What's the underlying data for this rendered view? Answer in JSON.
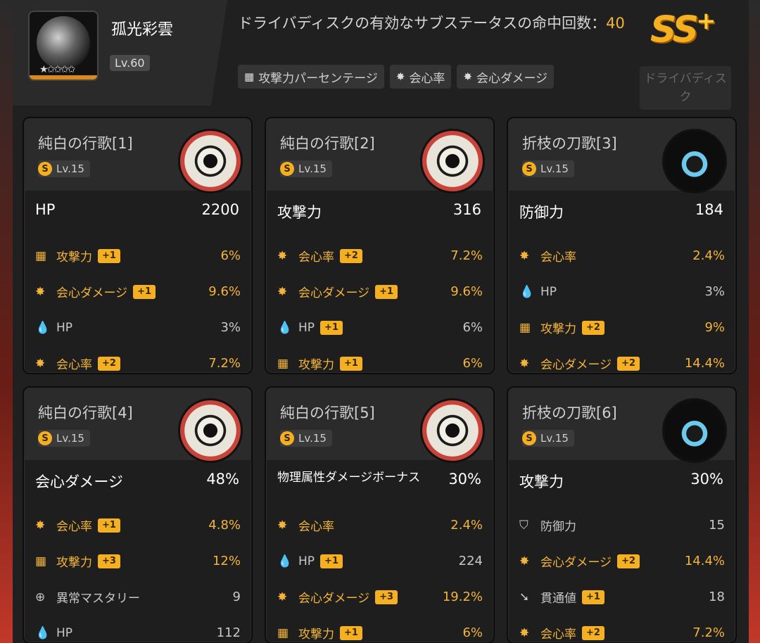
{
  "character": {
    "name": "孤光彩雲",
    "level": "Lv.60",
    "stars": "★✩✩✩✩"
  },
  "header": {
    "description_prefix": "ドライバディスクの有効なサブステータスの命中回数：",
    "description_count": "40",
    "tags": [
      {
        "icon": "attack-icon",
        "glyph": "▦",
        "label": "攻撃力パーセンテージ"
      },
      {
        "icon": "crit-icon",
        "glyph": "✸",
        "label": "会心率"
      },
      {
        "icon": "crit-icon",
        "glyph": "✸",
        "label": "会心ダメージ"
      }
    ],
    "rank": "SS",
    "rank_plus": "+",
    "disc_button": "ドライバディスク"
  },
  "colors": {
    "accent": "#f4b43a",
    "badge": "#f4b021",
    "card_bg": "#1e1e1e"
  },
  "cards": [
    {
      "title": "純白の行歌[1]",
      "level": "Lv.15",
      "disc": "white",
      "main_name": "HP",
      "main_value": "2200",
      "subs": [
        {
          "icon": "attack-icon",
          "glyph": "▦",
          "name": "攻撃力",
          "badge": "+1",
          "value": "6%",
          "active": true
        },
        {
          "icon": "crit-icon",
          "glyph": "✸",
          "name": "会心ダメージ",
          "badge": "+1",
          "value": "9.6%",
          "active": true
        },
        {
          "icon": "hp-icon",
          "glyph": "💧",
          "name": "HP",
          "badge": "",
          "value": "3%",
          "active": false
        },
        {
          "icon": "crit-icon",
          "glyph": "✸",
          "name": "会心率",
          "badge": "+2",
          "value": "7.2%",
          "active": true
        }
      ]
    },
    {
      "title": "純白の行歌[2]",
      "level": "Lv.15",
      "disc": "white",
      "main_name": "攻撃力",
      "main_value": "316",
      "subs": [
        {
          "icon": "crit-icon",
          "glyph": "✸",
          "name": "会心率",
          "badge": "+2",
          "value": "7.2%",
          "active": true
        },
        {
          "icon": "crit-icon",
          "glyph": "✸",
          "name": "会心ダメージ",
          "badge": "+1",
          "value": "9.6%",
          "active": true
        },
        {
          "icon": "hp-icon",
          "glyph": "💧",
          "name": "HP",
          "badge": "+1",
          "value": "6%",
          "active": false
        },
        {
          "icon": "attack-icon",
          "glyph": "▦",
          "name": "攻撃力",
          "badge": "+1",
          "value": "6%",
          "active": true
        }
      ]
    },
    {
      "title": "折枝の刀歌[3]",
      "level": "Lv.15",
      "disc": "blue",
      "main_name": "防御力",
      "main_value": "184",
      "subs": [
        {
          "icon": "crit-icon",
          "glyph": "✸",
          "name": "会心率",
          "badge": "",
          "value": "2.4%",
          "active": true
        },
        {
          "icon": "hp-icon",
          "glyph": "💧",
          "name": "HP",
          "badge": "",
          "value": "3%",
          "active": false
        },
        {
          "icon": "attack-icon",
          "glyph": "▦",
          "name": "攻撃力",
          "badge": "+2",
          "value": "9%",
          "active": true
        },
        {
          "icon": "crit-icon",
          "glyph": "✸",
          "name": "会心ダメージ",
          "badge": "+2",
          "value": "14.4%",
          "active": true
        }
      ]
    },
    {
      "title": "純白の行歌[4]",
      "level": "Lv.15",
      "disc": "white",
      "main_name": "会心ダメージ",
      "main_value": "48%",
      "subs": [
        {
          "icon": "crit-icon",
          "glyph": "✸",
          "name": "会心率",
          "badge": "+1",
          "value": "4.8%",
          "active": true
        },
        {
          "icon": "attack-icon",
          "glyph": "▦",
          "name": "攻撃力",
          "badge": "+3",
          "value": "12%",
          "active": true
        },
        {
          "icon": "anomaly-icon",
          "glyph": "⊕",
          "name": "異常マスタリー",
          "badge": "",
          "value": "9",
          "active": false
        },
        {
          "icon": "hp-icon",
          "glyph": "💧",
          "name": "HP",
          "badge": "",
          "value": "112",
          "active": false
        }
      ]
    },
    {
      "title": "純白の行歌[5]",
      "level": "Lv.15",
      "disc": "white",
      "main_name": "物理属性ダメージボーナス",
      "main_value": "30%",
      "subs": [
        {
          "icon": "crit-icon",
          "glyph": "✸",
          "name": "会心率",
          "badge": "",
          "value": "2.4%",
          "active": true
        },
        {
          "icon": "hp-icon",
          "glyph": "💧",
          "name": "HP",
          "badge": "+1",
          "value": "224",
          "active": false
        },
        {
          "icon": "crit-icon",
          "glyph": "✸",
          "name": "会心ダメージ",
          "badge": "+3",
          "value": "19.2%",
          "active": true
        },
        {
          "icon": "attack-icon",
          "glyph": "▦",
          "name": "攻撃力",
          "badge": "+1",
          "value": "6%",
          "active": true
        }
      ]
    },
    {
      "title": "折枝の刀歌[6]",
      "level": "Lv.15",
      "disc": "blue",
      "main_name": "攻撃力",
      "main_value": "30%",
      "subs": [
        {
          "icon": "defense-icon",
          "glyph": "⛉",
          "name": "防御力",
          "badge": "",
          "value": "15",
          "active": false
        },
        {
          "icon": "crit-icon",
          "glyph": "✸",
          "name": "会心ダメージ",
          "badge": "+2",
          "value": "14.4%",
          "active": true
        },
        {
          "icon": "pen-icon",
          "glyph": "➘",
          "name": "貫通値",
          "badge": "+1",
          "value": "18",
          "active": false
        },
        {
          "icon": "crit-icon",
          "glyph": "✸",
          "name": "会心率",
          "badge": "+2",
          "value": "7.2%",
          "active": true
        }
      ]
    }
  ]
}
